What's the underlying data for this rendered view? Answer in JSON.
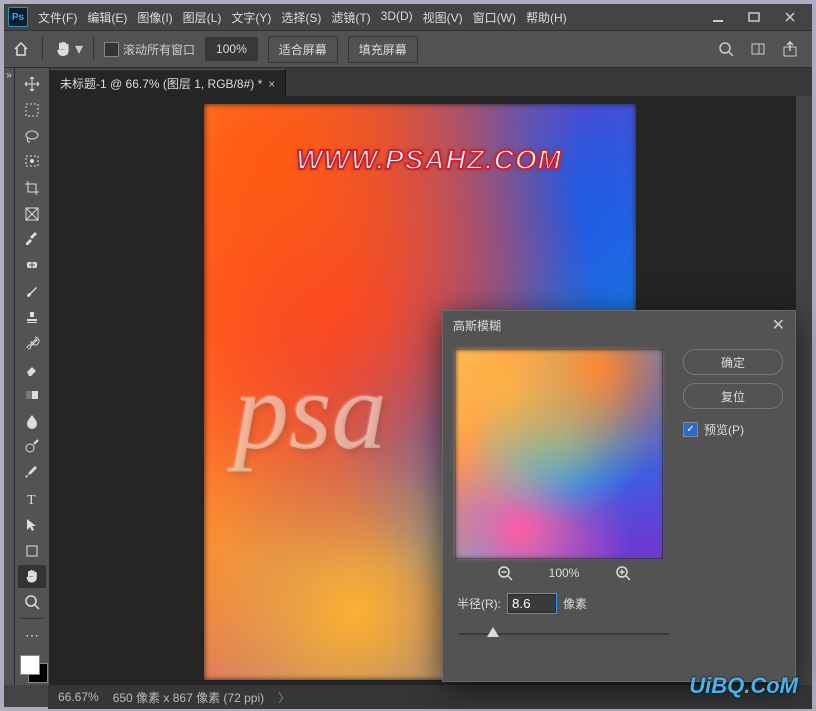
{
  "titlebar": {
    "ps_label": "Ps",
    "menus": [
      "文件(F)",
      "编辑(E)",
      "图像(I)",
      "图层(L)",
      "文字(Y)",
      "选择(S)",
      "滤镜(T)",
      "3D(D)",
      "视图(V)",
      "窗口(W)",
      "帮助(H)"
    ]
  },
  "optionbar": {
    "scroll_all_label": "滚动所有窗口",
    "zoom_value": "100%",
    "fit_screen": "适合屏幕",
    "fill_screen": "填充屏幕"
  },
  "tab": {
    "label": "未标题-1 @ 66.7% (图层 1, RGB/8#) *",
    "close": "×"
  },
  "canvas": {
    "watermark": "WWW.PSAHZ.COM",
    "script_text": "psa"
  },
  "dialog": {
    "title": "高斯模糊",
    "ok": "确定",
    "reset": "复位",
    "preview_label": "预览(P)",
    "zoom_pct": "100%",
    "radius_label": "半径(R):",
    "radius_value": "8.6",
    "radius_unit": "像素"
  },
  "status": {
    "zoom": "66.67%",
    "doc_info": "650 像素 x 867 像素 (72 ppi)"
  },
  "footer_watermark": "UiBQ.CoM"
}
